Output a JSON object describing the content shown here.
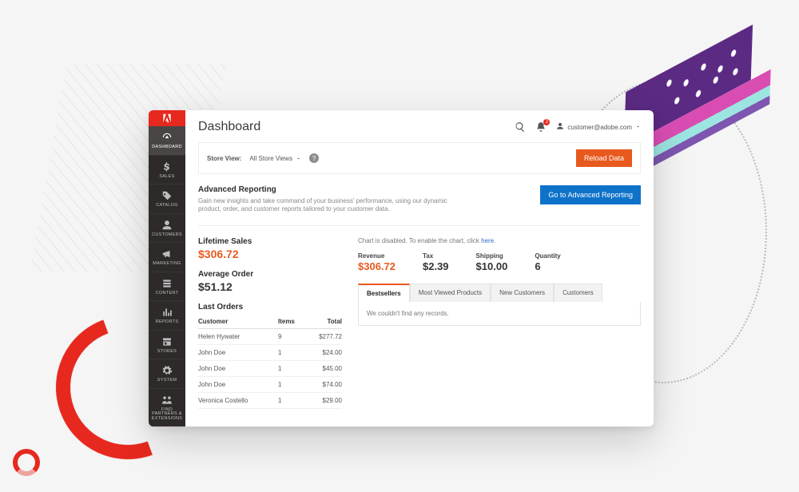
{
  "header": {
    "title": "Dashboard",
    "notifications_count": "2",
    "account_email": "customer@adobe.com"
  },
  "storebar": {
    "label": "Store View:",
    "selected": "All Store Views",
    "reload_btn": "Reload Data"
  },
  "advanced": {
    "title": "Advanced Reporting",
    "desc": "Gain new insights and take command of your business' performance, using our dynamic product, order, and customer reports tailored to your customer data.",
    "btn": "Go to Advanced Reporting"
  },
  "stats": {
    "lifetime_label": "Lifetime Sales",
    "lifetime_value": "$306.72",
    "avg_label": "Average Order",
    "avg_value": "$51.12"
  },
  "orders": {
    "title": "Last Orders",
    "col_customer": "Customer",
    "col_items": "Items",
    "col_total": "Total",
    "rows": [
      {
        "c": "Helen Hywater",
        "i": "9",
        "t": "$277.72"
      },
      {
        "c": "John Doe",
        "i": "1",
        "t": "$24.00"
      },
      {
        "c": "John Doe",
        "i": "1",
        "t": "$45.00"
      },
      {
        "c": "John Doe",
        "i": "1",
        "t": "$74.00"
      },
      {
        "c": "Veronica Costello",
        "i": "1",
        "t": "$29.00"
      }
    ]
  },
  "chart_notice": {
    "prefix": "Chart is disabled. To enable the chart, click ",
    "link": "here",
    "suffix": "."
  },
  "metrics": {
    "revenue": {
      "label": "Revenue",
      "value": "$306.72"
    },
    "tax": {
      "label": "Tax",
      "value": "$2.39"
    },
    "shipping": {
      "label": "Shipping",
      "value": "$10.00"
    },
    "quantity": {
      "label": "Quantity",
      "value": "6"
    }
  },
  "tabs": {
    "items": [
      "Bestsellers",
      "Most Viewed Products",
      "New Customers",
      "Customers"
    ],
    "empty": "We couldn't find any records."
  },
  "sidebar": {
    "items": [
      {
        "label": "DASHBOARD",
        "active": true,
        "icon": "gauge"
      },
      {
        "label": "SALES",
        "icon": "dollar"
      },
      {
        "label": "CATALOG",
        "icon": "tag"
      },
      {
        "label": "CUSTOMERS",
        "icon": "user"
      },
      {
        "label": "MARKETING",
        "icon": "megaphone"
      },
      {
        "label": "CONTENT",
        "icon": "layers"
      },
      {
        "label": "REPORTS",
        "icon": "bars"
      },
      {
        "label": "STORES",
        "icon": "store"
      },
      {
        "label": "SYSTEM",
        "icon": "gear"
      },
      {
        "label": "FIND PARTNERS & EXTENSIONS",
        "icon": "partners"
      }
    ]
  }
}
